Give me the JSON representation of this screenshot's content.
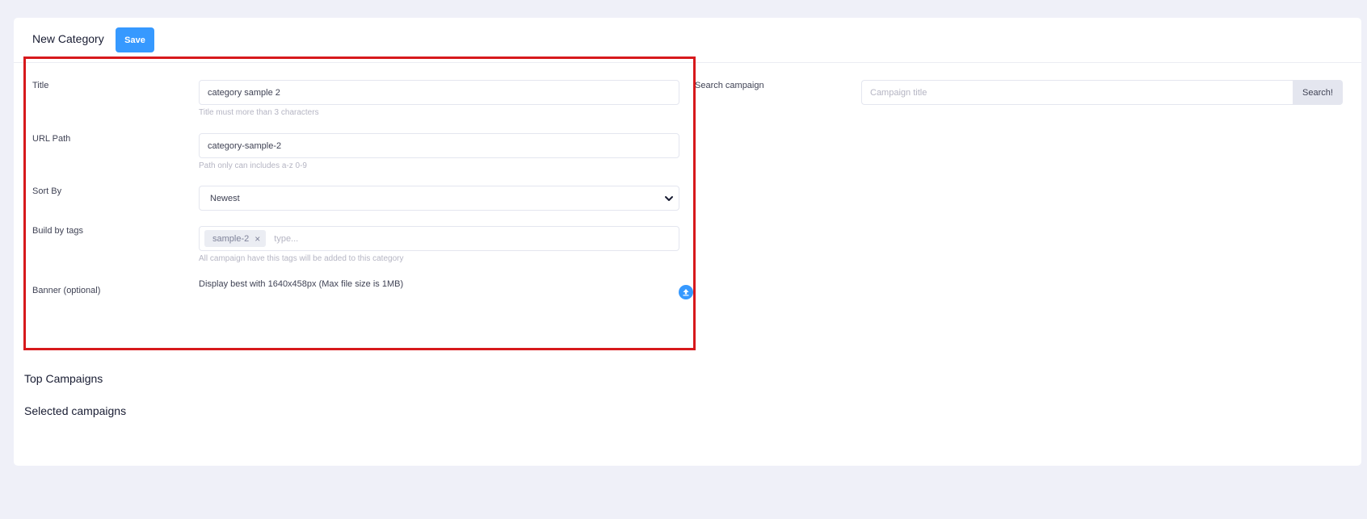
{
  "header": {
    "title": "New Category",
    "save_label": "Save"
  },
  "form": {
    "title": {
      "label": "Title",
      "value": "category sample 2",
      "hint": "Title must more than 3 characters"
    },
    "url_path": {
      "label": "URL Path",
      "value": "category-sample-2",
      "hint": "Path only can includes a-z 0-9"
    },
    "sort_by": {
      "label": "Sort By",
      "selected": "Newest"
    },
    "tags": {
      "label": "Build by tags",
      "chips": [
        "sample-2"
      ],
      "remove_glyph": "×",
      "placeholder": "type...",
      "hint": "All campaign have this tags will be added to this category"
    },
    "banner": {
      "label": "Banner (optional)",
      "info": "Display best with 1640x458px (Max file size is 1MB)",
      "upload_icon": "upload-icon"
    }
  },
  "search": {
    "label": "Search campaign",
    "placeholder": "Campaign title",
    "button_label": "Search!"
  },
  "sections": {
    "top_campaigns": "Top Campaigns",
    "selected_campaigns": "Selected campaigns"
  },
  "colors": {
    "primary": "#3699ff",
    "highlight_border": "#d7191c",
    "background": "#eff0f8"
  }
}
